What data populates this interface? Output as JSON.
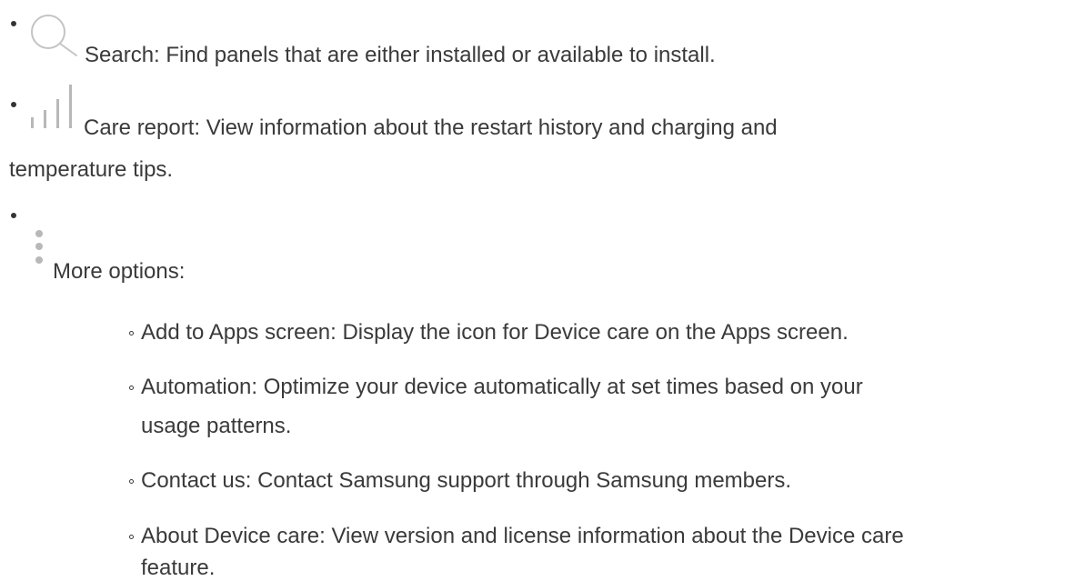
{
  "items": [
    {
      "icon": "search-icon",
      "label": "Search",
      "text": "Search: Find panels that are either installed or available to install."
    },
    {
      "icon": "bar-chart-icon",
      "label": "Care report",
      "text_line1": "Care report: View information about the restart history and charging and",
      "text_line2": "temperature tips."
    },
    {
      "icon": "more-options-icon",
      "label": "More options",
      "text": "More options:",
      "sub_items": [
        {
          "text": "Add to Apps screen: Display the icon for Device care on the Apps screen."
        },
        {
          "text_line1": "Automation: Optimize your device automatically at set times based on your",
          "text_line2": "usage patterns."
        },
        {
          "text": "Contact us: Contact Samsung support through Samsung members."
        },
        {
          "text_line1": "About Device care: View version and license information about the Device care",
          "text_line2": "feature."
        }
      ]
    }
  ],
  "colors": {
    "text": "#3a3a3a",
    "icon": "#b0b0b0",
    "bullet": "#333333"
  }
}
